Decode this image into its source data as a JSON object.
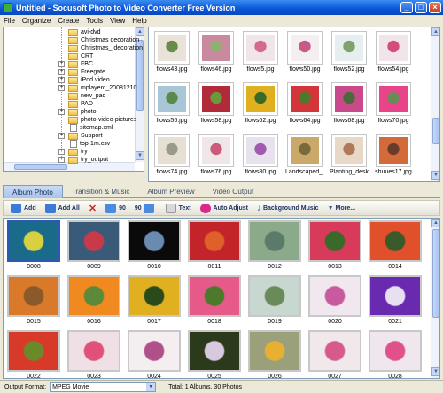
{
  "window": {
    "title": "Untitled - Socusoft Photo to Video Converter Free Version"
  },
  "menu": [
    "File",
    "Organize",
    "Create",
    "Tools",
    "View",
    "Help"
  ],
  "folders": [
    {
      "label": "avi-dvd",
      "type": "folder",
      "expand": false
    },
    {
      "label": "Christmas decoration",
      "type": "folder",
      "expand": false
    },
    {
      "label": "Christmas_ decoration",
      "type": "folder",
      "expand": false
    },
    {
      "label": "CRT",
      "type": "folder",
      "expand": false
    },
    {
      "label": "FBC",
      "type": "folder",
      "expand": true
    },
    {
      "label": "Freegate",
      "type": "folder",
      "expand": true
    },
    {
      "label": "iPod video",
      "type": "folder",
      "expand": true
    },
    {
      "label": "mplayerc_20081210",
      "type": "folder",
      "expand": true
    },
    {
      "label": "new_pad",
      "type": "folder",
      "expand": false
    },
    {
      "label": "PAD",
      "type": "folder",
      "expand": false
    },
    {
      "label": "photo",
      "type": "folder",
      "expand": true
    },
    {
      "label": "photo-video-pictures",
      "type": "folder",
      "expand": false
    },
    {
      "label": "sitemap.xml",
      "type": "file",
      "expand": false
    },
    {
      "label": "Support",
      "type": "folder",
      "expand": true
    },
    {
      "label": "top-1m.csv",
      "type": "file",
      "expand": false
    },
    {
      "label": "try",
      "type": "folder",
      "expand": true
    },
    {
      "label": "try_output",
      "type": "folder",
      "expand": true
    }
  ],
  "gallery": [
    {
      "label": "flows43.jpg",
      "color": "#e8e2d8",
      "accent": "#6a8a4a"
    },
    {
      "label": "flows46.jpg",
      "color": "#c98aa0",
      "accent": "#8fb070"
    },
    {
      "label": "flows5.jpg",
      "color": "#f0e6ea",
      "accent": "#d46a8f"
    },
    {
      "label": "flows50.jpg",
      "color": "#f3eef0",
      "accent": "#c75a86"
    },
    {
      "label": "flows52.jpg",
      "color": "#e6eef0",
      "accent": "#7fa36a"
    },
    {
      "label": "flows54.jpg",
      "color": "#f1e4ea",
      "accent": "#d24f7a"
    },
    {
      "label": "flows56.jpg",
      "color": "#a9c6d6",
      "accent": "#5a8a4a"
    },
    {
      "label": "flows58.jpg",
      "color": "#b02a3a",
      "accent": "#6a9a3a"
    },
    {
      "label": "flows62.jpg",
      "color": "#e0b020",
      "accent": "#3a6a2a"
    },
    {
      "label": "flows64.jpg",
      "color": "#d2363a",
      "accent": "#4a7a2a"
    },
    {
      "label": "flows68.jpg",
      "color": "#c84a8a",
      "accent": "#4a6a3a"
    },
    {
      "label": "flows70.jpg",
      "color": "#e8448a",
      "accent": "#6a8a5a"
    },
    {
      "label": "flows74.jpg",
      "color": "#e6e0d4",
      "accent": "#9a9a8a"
    },
    {
      "label": "flows76.jpg",
      "color": "#efe6e8",
      "accent": "#cc5a7a"
    },
    {
      "label": "flows80.jpg",
      "color": "#e8e2ee",
      "accent": "#a05ab0"
    },
    {
      "label": "Landscaped_...",
      "color": "#c9a86a",
      "accent": "#7a6a3a"
    },
    {
      "label": "Planting_desk...",
      "color": "#e8d8c8",
      "accent": "#b07a5a"
    },
    {
      "label": "shuues17.jpg",
      "color": "#d26a3a",
      "accent": "#6a3a2a"
    }
  ],
  "tabs": [
    "Album Photo",
    "Transition & Music",
    "Album Preview",
    "Video Output"
  ],
  "toolbar": [
    {
      "label": "Add",
      "color": "#3c7ad8"
    },
    {
      "label": "Add All",
      "color": "#3c7ad8"
    },
    {
      "label": "",
      "color": "#cc2a2a"
    },
    {
      "label": "90",
      "color": "#4a8ae0"
    },
    {
      "label": "90",
      "color": "#4a8ae0"
    },
    {
      "label": "Text",
      "color": "#d8d8d8"
    },
    {
      "label": "Auto Adjust",
      "color": "#d82a8a"
    },
    {
      "label": "Background Music",
      "color": "#2a5ab0"
    },
    {
      "label": "More...",
      "color": "#ece9d8"
    }
  ],
  "album": [
    {
      "label": "0008",
      "color": "#1a6a8a",
      "accent": "#d8d040",
      "selected": true
    },
    {
      "label": "0009",
      "color": "#3a5a7a",
      "accent": "#c83a4a",
      "selected": false
    },
    {
      "label": "0010",
      "color": "#0a0a0a",
      "accent": "#6a8ab0",
      "selected": false
    },
    {
      "label": "0011",
      "color": "#c2242a",
      "accent": "#e0602a",
      "selected": false
    },
    {
      "label": "0012",
      "color": "#8aaa8a",
      "accent": "#5a7a6a",
      "selected": false
    },
    {
      "label": "0013",
      "color": "#d83a5a",
      "accent": "#3a6a2a",
      "selected": false
    },
    {
      "label": "0014",
      "color": "#e0502a",
      "accent": "#3a5a2a",
      "selected": false
    },
    {
      "label": "0015",
      "color": "#d87a2a",
      "accent": "#8a5a2a",
      "selected": false
    },
    {
      "label": "0016",
      "color": "#f08a20",
      "accent": "#5a8a3a",
      "selected": false
    },
    {
      "label": "0017",
      "color": "#e0b020",
      "accent": "#2a4a1a",
      "selected": false
    },
    {
      "label": "0018",
      "color": "#e65a8a",
      "accent": "#4a7a2a",
      "selected": false
    },
    {
      "label": "0019",
      "color": "#c8d8d0",
      "accent": "#6a8a5a",
      "selected": false
    },
    {
      "label": "0020",
      "color": "#f0e8ee",
      "accent": "#c85aa0",
      "selected": false
    },
    {
      "label": "0021",
      "color": "#6a2ab0",
      "accent": "#e8e0f0",
      "selected": false
    },
    {
      "label": "0022",
      "color": "#d83a2a",
      "accent": "#6a8a2a",
      "selected": false
    },
    {
      "label": "0023",
      "color": "#f0e0e6",
      "accent": "#e0507a",
      "selected": false
    },
    {
      "label": "0024",
      "color": "#f4eef0",
      "accent": "#b0508a",
      "selected": false
    },
    {
      "label": "0025",
      "color": "#2a3a1a",
      "accent": "#d8c8e0",
      "selected": false
    },
    {
      "label": "0026",
      "color": "#9aa07a",
      "accent": "#e8b030",
      "selected": false
    },
    {
      "label": "0027",
      "color": "#f0e8ea",
      "accent": "#d85a8a",
      "selected": false
    },
    {
      "label": "0028",
      "color": "#f0e6ee",
      "accent": "#e0508a",
      "selected": false
    }
  ],
  "status": {
    "format_label": "Output Format:",
    "format_value": "MPEG Movie",
    "total": "Total: 1 Albums, 30 Photos"
  }
}
